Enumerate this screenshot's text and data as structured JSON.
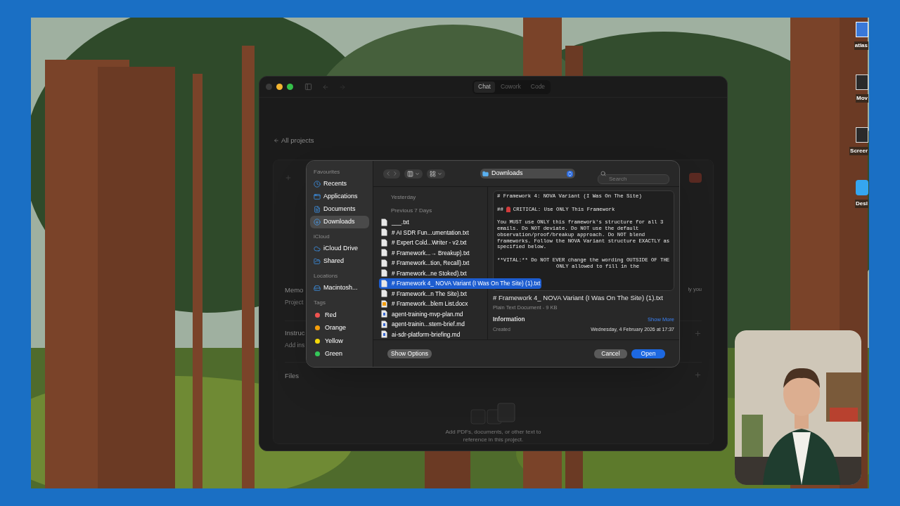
{
  "desktop": {
    "icons": [
      {
        "label": "atlas"
      },
      {
        "label": "Mov"
      },
      {
        "label": "Screer"
      },
      {
        "label": "Desl"
      }
    ]
  },
  "app_window": {
    "tabs": [
      {
        "label": "Chat",
        "selected": true
      },
      {
        "label": "Cowork",
        "selected": false
      },
      {
        "label": "Code",
        "selected": false
      }
    ],
    "back_link": "All projects",
    "sections": [
      {
        "title": "Memo",
        "subtitle": "Project"
      },
      {
        "title": "Instruc",
        "subtitle": "Add ins"
      },
      {
        "title": "Files"
      }
    ],
    "memory_hint": "ly you",
    "files_empty": "Add PDFs, documents, or other text to reference in this project."
  },
  "dialog": {
    "location": "Downloads",
    "search": {
      "placeholder": "Search"
    },
    "sidebar": [
      {
        "header": "Favourites",
        "items": [
          {
            "label": "Recents",
            "selected": false
          },
          {
            "label": "Applications",
            "selected": false
          },
          {
            "label": "Documents",
            "selected": false
          },
          {
            "label": "Downloads",
            "selected": true
          }
        ]
      },
      {
        "header": "iCloud",
        "items": [
          {
            "label": "iCloud Drive",
            "selected": false
          },
          {
            "label": "Shared",
            "selected": false
          }
        ]
      },
      {
        "header": "Locations",
        "items": [
          {
            "label": "Macintosh...",
            "selected": false
          }
        ]
      }
    ],
    "tags": {
      "header": "Tags",
      "items": [
        {
          "label": "Red",
          "color": "#ef5350"
        },
        {
          "label": "Orange",
          "color": "#f59e0b"
        },
        {
          "label": "Yellow",
          "color": "#f5d90a"
        },
        {
          "label": "Green",
          "color": "#34c759"
        }
      ]
    },
    "list_headers": [
      "Yesterday",
      "Previous 7 Days"
    ],
    "files": [
      {
        "name": "___.txt",
        "kind": "text",
        "selected": false
      },
      {
        "name": "# AI SDR Fun...umentation.txt",
        "kind": "text",
        "selected": false
      },
      {
        "name": "# Expert Cold...Writer - v2.txt",
        "kind": "text",
        "selected": false
      },
      {
        "name": "# Framework...→ Breakup).txt",
        "kind": "text",
        "selected": false
      },
      {
        "name": "# Framework...tion, Recall).txt",
        "kind": "text",
        "selected": false
      },
      {
        "name": "# Framework...ne Stoked).txt",
        "kind": "text",
        "selected": false
      },
      {
        "name": "# Framework 4_ NOVA Variant (I Was On The Site) (1).txt",
        "kind": "text",
        "selected": true
      },
      {
        "name": "# Framework...n The Site).txt",
        "kind": "text",
        "selected": false
      },
      {
        "name": "# Framework...blem List.docx",
        "kind": "word",
        "selected": false
      },
      {
        "name": "agent-training-mvp-plan.md",
        "kind": "markdown",
        "selected": false
      },
      {
        "name": "agent-trainin...stem-brief.md",
        "kind": "markdown",
        "selected": false
      },
      {
        "name": "ai-sdr-platform-briefing.md",
        "kind": "markdown",
        "selected": false
      }
    ],
    "preview": {
      "lines": [
        {
          "kind": "plain",
          "text": "# Framework 4: NOVA Variant (I Was On The Site)"
        },
        {
          "kind": "alert",
          "prefix": "##",
          "text": "CRITICAL: Use ONLY This Framework"
        },
        {
          "kind": "plain",
          "text": "You MUST use ONLY this framework's structure for all 3\nemails. Do NOT deviate. Do NOT use the default\nobservation/proof/breakup approach. Do NOT blend\nframeworks. Follow the NOVA Variant structure EXACTLY as\nspecified below."
        },
        {
          "kind": "plain",
          "text": "**VITAL:** Do NOT EVER change the wording OUTSIDE OF THE"
        },
        {
          "kind": "covered",
          "text": "ONLY allowed to fill in the"
        }
      ]
    },
    "info": {
      "title": "# Framework 4_ NOVA Variant (I Was On The Site) (1).txt",
      "subtitle": "Plain Text Document - 9 KB",
      "heading": "Information",
      "more": "Show More",
      "created_label": "Created",
      "created_value": "Wednesday, 4 February 2026 at 17:37"
    },
    "buttons": {
      "options": "Show Options",
      "cancel": "Cancel",
      "open": "Open"
    }
  }
}
